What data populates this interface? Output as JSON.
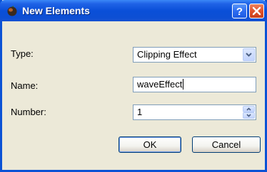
{
  "window": {
    "title": "New Elements",
    "app_icon": "pumpkin-icon",
    "help_icon": "help-icon",
    "close_icon": "close-icon"
  },
  "form": {
    "type": {
      "label": "Type:",
      "value": "Clipping Effect"
    },
    "name": {
      "label": "Name:",
      "value": "waveEffect"
    },
    "number": {
      "label": "Number:",
      "value": "1"
    }
  },
  "buttons": {
    "ok": "OK",
    "cancel": "Cancel"
  },
  "colors": {
    "titlebar": "#0a4fd8",
    "frame": "#0b52d5",
    "dialog_bg": "#ece9d8",
    "close_button": "#e0522c"
  }
}
